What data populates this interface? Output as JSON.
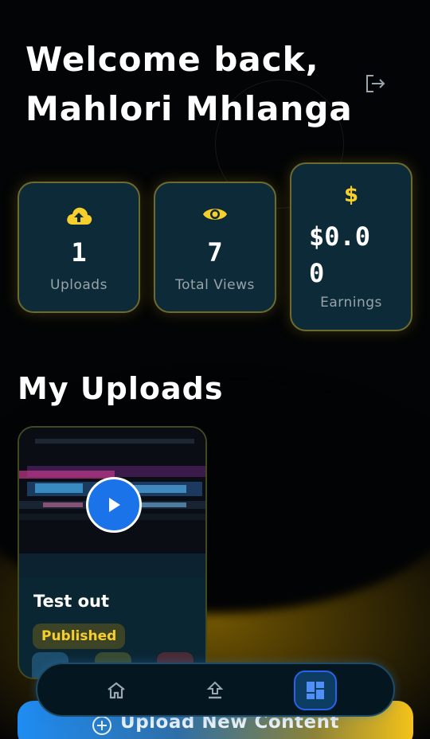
{
  "header": {
    "line1": "Welcome back,",
    "line2": "Mahlori Mhlanga",
    "logout_icon": "logout-icon"
  },
  "stats": [
    {
      "icon": "cloud-upload-icon",
      "value": "1",
      "label": "Uploads"
    },
    {
      "icon": "eye-icon",
      "value": "7",
      "label": "Total Views"
    },
    {
      "icon": "dollar-icon",
      "value_line1": "$0.0",
      "value_line2": "0",
      "label": "Earnings"
    }
  ],
  "section": {
    "title": "My Uploads"
  },
  "uploads": [
    {
      "title": "Test out",
      "status": "Published",
      "thumbnail_icon": "video-thumbnail",
      "play_icon": "play-icon"
    }
  ],
  "nav": {
    "items": [
      {
        "icon": "home-icon"
      },
      {
        "icon": "upload-icon"
      },
      {
        "icon": "dashboard-icon",
        "active": true
      }
    ]
  },
  "upload_button": {
    "label": "Upload New Content",
    "icon": "plus-circle-icon"
  },
  "colors": {
    "accent_yellow": "#f6cf2c",
    "accent_blue": "#1a73e8",
    "card_bg": "#0d2a38",
    "card_border": "#6d6a2e"
  }
}
